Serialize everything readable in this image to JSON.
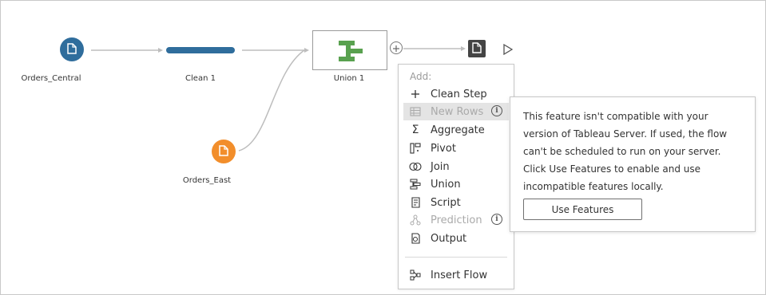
{
  "flow": {
    "nodes": {
      "orders_central": {
        "label": "Orders_Central",
        "icon": "file-icon",
        "color": "#2f6d9c"
      },
      "clean1": {
        "label": "Clean 1",
        "color": "#2f6d9c"
      },
      "orders_east": {
        "label": "Orders_East",
        "icon": "file-icon",
        "color": "#f28e2b"
      },
      "union1": {
        "label": "Union 1",
        "icon": "union-icon",
        "color": "#59a14f"
      },
      "output": {
        "icon": "output-file-icon",
        "color": "#444444"
      }
    },
    "add_icon": "plus-icon",
    "run_icon": "play-icon"
  },
  "menu": {
    "header": "Add:",
    "items": [
      {
        "label": "Clean Step",
        "icon": "plus-icon",
        "disabled": false
      },
      {
        "label": "New Rows",
        "icon": "new-rows-icon",
        "disabled": true,
        "info": true
      },
      {
        "label": "Aggregate",
        "icon": "sigma-icon",
        "disabled": false
      },
      {
        "label": "Pivot",
        "icon": "pivot-icon",
        "disabled": false
      },
      {
        "label": "Join",
        "icon": "join-icon",
        "disabled": false
      },
      {
        "label": "Union",
        "icon": "union-icon",
        "disabled": false
      },
      {
        "label": "Script",
        "icon": "script-icon",
        "disabled": false
      },
      {
        "label": "Prediction",
        "icon": "prediction-icon",
        "disabled": true,
        "info": true
      },
      {
        "label": "Output",
        "icon": "output-icon",
        "disabled": false
      }
    ],
    "footer_item": {
      "label": "Insert Flow",
      "icon": "insert-flow-icon"
    }
  },
  "tooltip": {
    "lines": [
      "This feature isn't compatible with your",
      "version of Tableau Server. If used, the flow",
      "can't be scheduled to run on your server.",
      "Click Use Features to enable and use",
      "incompatible features locally."
    ],
    "button": "Use Features"
  },
  "colors": {
    "link": "#bdbdbd",
    "menu_highlight": "#e4e4e4",
    "disabled_text": "#aaaaaa"
  }
}
